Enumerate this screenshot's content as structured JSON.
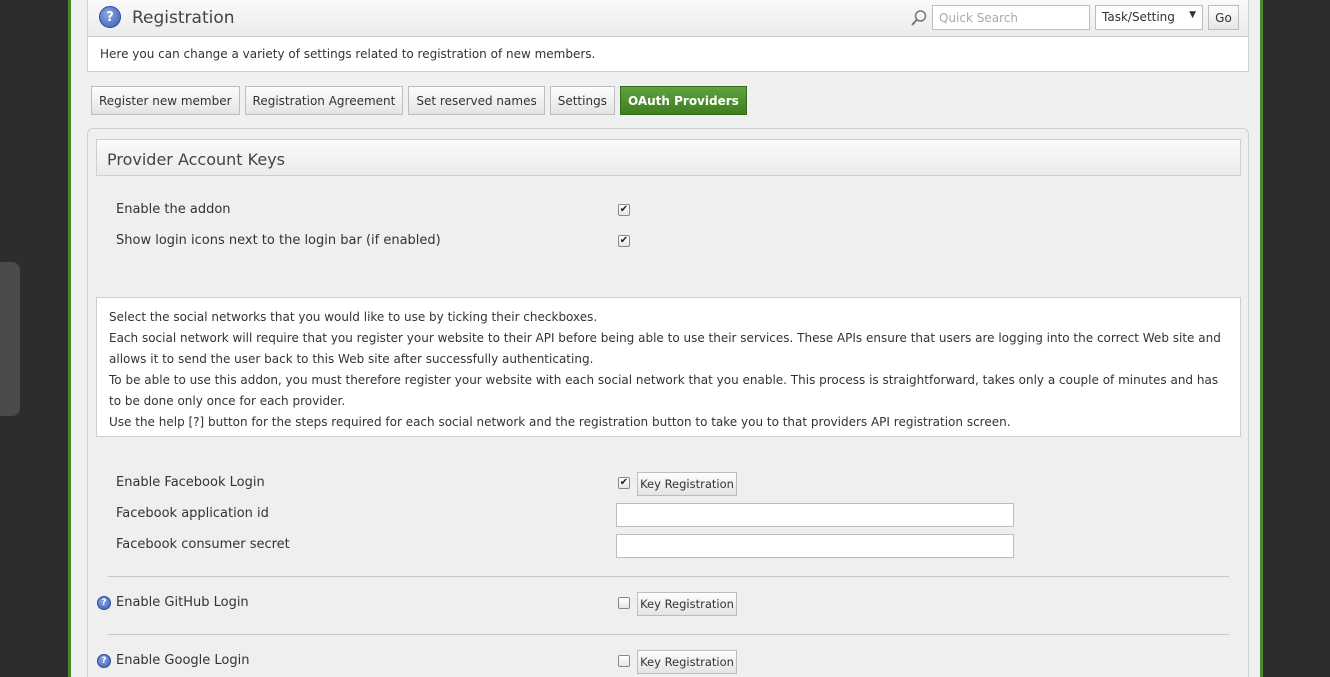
{
  "header": {
    "title": "Registration",
    "help_glyph": "?",
    "search_placeholder": "Quick Search",
    "task_select_value": "Task/Setting",
    "go_label": "Go"
  },
  "description": "Here you can change a variety of settings related to registration of new members.",
  "tabs": [
    {
      "label": "Register new member",
      "active": false
    },
    {
      "label": "Registration Agreement",
      "active": false
    },
    {
      "label": "Set reserved names",
      "active": false
    },
    {
      "label": "Settings",
      "active": false
    },
    {
      "label": "OAuth Providers",
      "active": true
    }
  ],
  "panel": {
    "title": "Provider Account Keys",
    "general_settings": [
      {
        "label": "Enable the addon",
        "checked": true
      },
      {
        "label": "Show login icons next to the login bar (if enabled)",
        "checked": true
      }
    ],
    "info_lines": [
      "Select the social networks that you would like to use by ticking their checkboxes.",
      "Each social network will require that you register your website to their API before being able to use their services. These APIs ensure that users are logging into the correct Web site and allows it to send the user back to this Web site after successfully authenticating.",
      "To be able to use this addon, you must therefore register your website with each social network that you enable. This process is straightforward, takes only a couple of minutes and has to be done only once for each provider.",
      "Use the help [?] button for the steps required for each social network and the registration button to take you to that providers API registration screen."
    ],
    "providers": {
      "facebook": {
        "enable_label": "Enable Facebook Login",
        "checked": true,
        "key_button": "Key Registration",
        "app_id_label": "Facebook application id",
        "app_id_value": "",
        "secret_label": "Facebook consumer secret",
        "secret_value": ""
      },
      "github": {
        "enable_label": "Enable GitHub Login",
        "checked": false,
        "key_button": "Key Registration"
      },
      "google": {
        "enable_label": "Enable Google Login",
        "checked": false,
        "key_button": "Key Registration"
      }
    }
  },
  "icons": {
    "help": "help-icon",
    "search": "search-icon",
    "checkmark": "✔"
  },
  "colors": {
    "accent_green": "#4a8a2a",
    "active_tab": "#3f7e22",
    "help_blue": "#3a5db5"
  }
}
